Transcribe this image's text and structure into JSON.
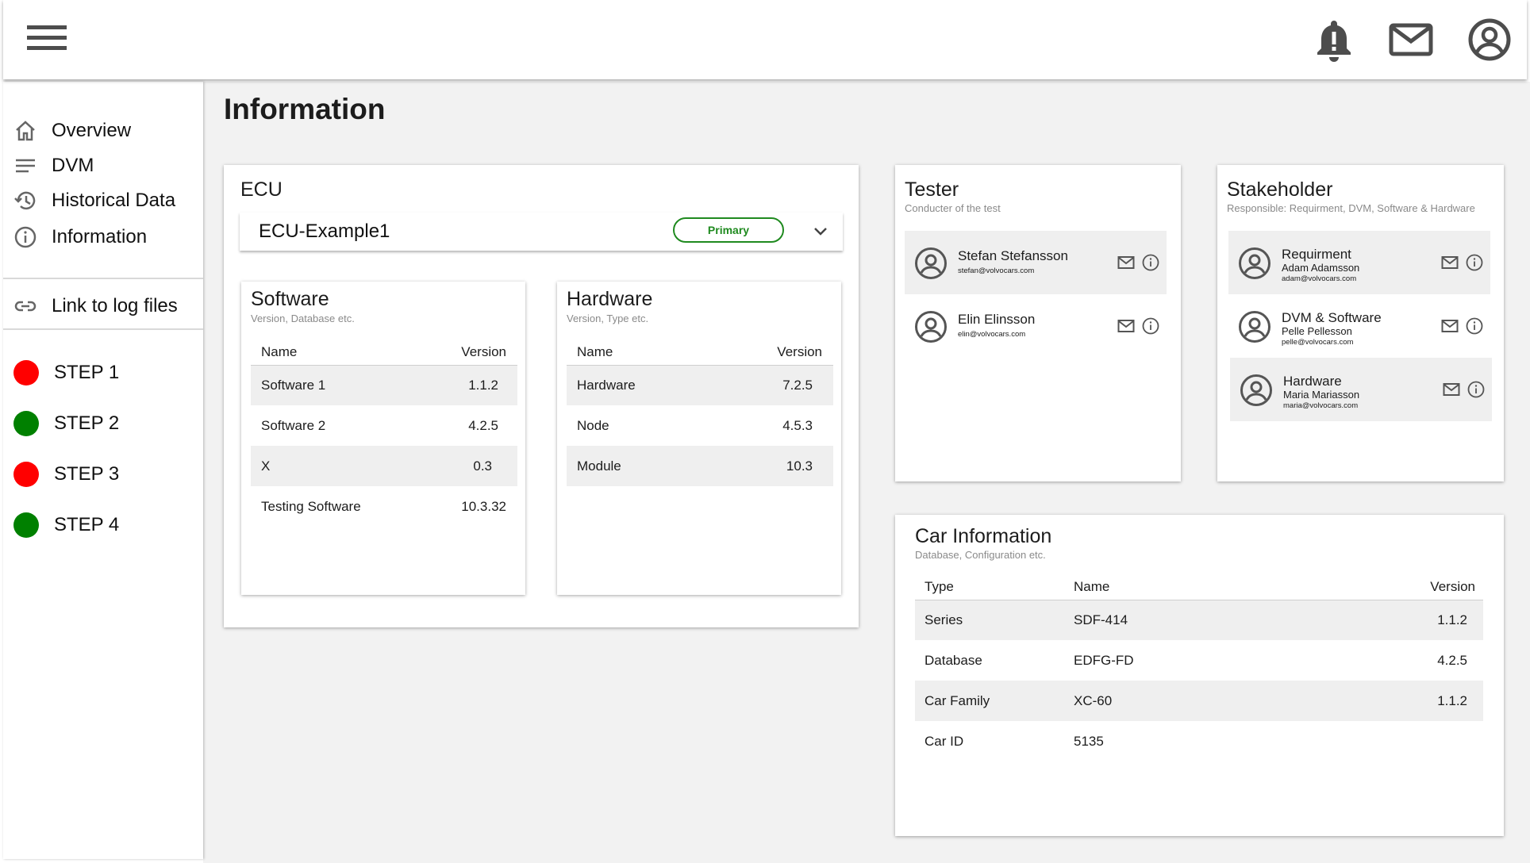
{
  "header": {
    "menu_icon": "hamburger-menu-icon",
    "notification_icon": "bell-alert-icon",
    "mail_icon": "envelope-icon",
    "account_icon": "user-circle-icon"
  },
  "sidebar": {
    "items": [
      {
        "label": "Overview",
        "icon": "home-icon"
      },
      {
        "label": "DVM",
        "icon": "lines-icon"
      },
      {
        "label": "Historical Data",
        "icon": "history-icon"
      },
      {
        "label": "Information",
        "icon": "info-icon"
      }
    ],
    "log_link": {
      "label": "Link to log files",
      "icon": "link-icon"
    },
    "steps": [
      {
        "label": "STEP 1",
        "status_color": "#ff0000"
      },
      {
        "label": "STEP 2",
        "status_color": "#008000"
      },
      {
        "label": "STEP 3",
        "status_color": "#ff0000"
      },
      {
        "label": "STEP 4",
        "status_color": "#008000"
      }
    ]
  },
  "main": {
    "title": "Information",
    "ecu": {
      "title": "ECU",
      "selected": "ECU-Example1",
      "badge": "Primary",
      "software": {
        "title": "Software",
        "subtitle": "Version, Database etc.",
        "columns": [
          "Name",
          "Version"
        ],
        "rows": [
          [
            "Software 1",
            "1.1.2"
          ],
          [
            "Software 2",
            "4.2.5"
          ],
          [
            "X",
            "0.3"
          ],
          [
            "Testing Software",
            "10.3.32"
          ]
        ]
      },
      "hardware": {
        "title": "Hardware",
        "subtitle": "Version, Type etc.",
        "columns": [
          "Name",
          "Version"
        ],
        "rows": [
          [
            "Hardware",
            "7.2.5"
          ],
          [
            "Node",
            "4.5.3"
          ],
          [
            "Module",
            "10.3"
          ]
        ]
      }
    },
    "tester": {
      "title": "Tester",
      "subtitle": "Conducter of the test",
      "people": [
        {
          "name": "Stefan Stefansson",
          "email": "stefan@volvocars.com"
        },
        {
          "name": "Elin Elinsson",
          "email": "elin@volvocars.com"
        }
      ]
    },
    "stakeholder": {
      "title": "Stakeholder",
      "subtitle": "Responsible: Requirment, DVM, Software & Hardware",
      "people": [
        {
          "role": "Requirment",
          "name": "Adam Adamsson",
          "email": "adam@volvocars.com"
        },
        {
          "role": "DVM & Software",
          "name": "Pelle Pellesson",
          "email": "pelle@volvocars.com"
        },
        {
          "role": "Hardware",
          "name": "Maria Mariasson",
          "email": "maria@volvocars.com"
        }
      ]
    },
    "car_info": {
      "title": "Car Information",
      "subtitle": "Database, Configuration etc.",
      "columns": [
        "Type",
        "Name",
        "Version"
      ],
      "rows": [
        [
          "Series",
          "SDF-414",
          "1.1.2"
        ],
        [
          "Database",
          "EDFG-FD",
          "4.2.5"
        ],
        [
          "Car Family",
          "XC-60",
          "1.1.2"
        ],
        [
          "Car ID",
          "5135",
          ""
        ]
      ]
    }
  }
}
